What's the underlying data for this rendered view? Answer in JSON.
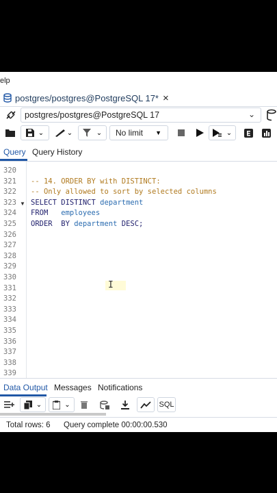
{
  "menu": {
    "partial_item": "elp"
  },
  "editor_tab": {
    "title": "postgres/postgres@PostgreSQL 17*",
    "close": "×"
  },
  "connection": {
    "value": "postgres/postgres@PostgreSQL 17"
  },
  "toolbar": {
    "limit_label": "No limit"
  },
  "query_tabs": [
    "Query",
    "Query History"
  ],
  "editor": {
    "line_numbers": [
      "320",
      "321",
      "322",
      "323",
      "324",
      "325",
      "326",
      "327",
      "328",
      "329",
      "330",
      "331",
      "332",
      "333",
      "334",
      "335",
      "336",
      "337",
      "338",
      "339"
    ],
    "code_lines": [
      {
        "segments": []
      },
      {
        "segments": [
          {
            "t": "-- 14. ORDER BY with DISTINCT:",
            "c": "cmt"
          }
        ]
      },
      {
        "segments": [
          {
            "t": "-- Only allowed to sort by selected columns",
            "c": "cmt"
          }
        ]
      },
      {
        "segments": [
          {
            "t": "SELECT DISTINCT ",
            "c": "kw"
          },
          {
            "t": "department",
            "c": "id"
          }
        ]
      },
      {
        "segments": [
          {
            "t": "FROM   ",
            "c": "kw"
          },
          {
            "t": "employees",
            "c": "id"
          }
        ]
      },
      {
        "segments": [
          {
            "t": "ORDER  BY ",
            "c": "kw"
          },
          {
            "t": "department",
            "c": "id"
          },
          {
            "t": " DESC;",
            "c": "kw"
          }
        ]
      }
    ]
  },
  "output_tabs": [
    "Data Output",
    "Messages",
    "Notifications"
  ],
  "output_toolbar": {
    "sql_label": "SQL"
  },
  "status": {
    "total_rows": "Total rows: 6",
    "query_complete": "Query complete 00:00:00.530"
  },
  "colors": {
    "accent": "#2057a6",
    "comment": "#b07a1f",
    "keyword": "#1d1d6b",
    "identifier": "#2b6cb0"
  }
}
